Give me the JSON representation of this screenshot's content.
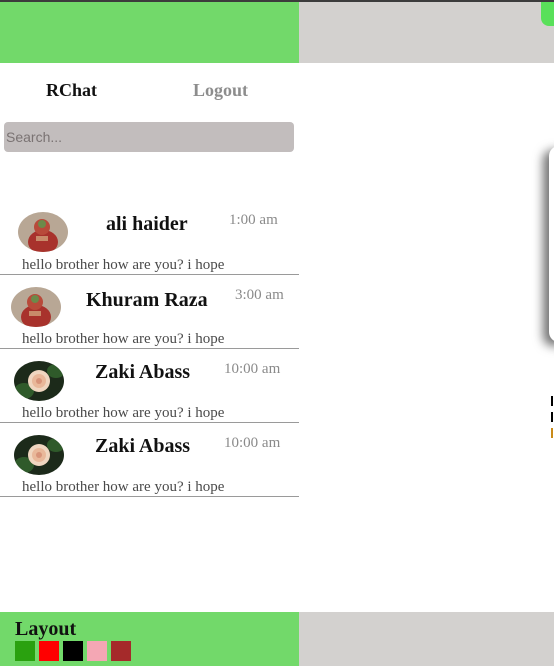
{
  "header": {
    "brand": "RChat",
    "logout_label": "Logout"
  },
  "search": {
    "placeholder": "Search...",
    "value": ""
  },
  "chats": [
    {
      "name": "ali haider",
      "time": "1:00 am",
      "preview": "hello brother how are you? i hope",
      "avatar": "avatar-red-portrait"
    },
    {
      "name": "Khuram Raza",
      "time": "3:00 am",
      "preview": "hello brother how are you? i hope",
      "avatar": "avatar-red-portrait"
    },
    {
      "name": "Zaki Abass",
      "time": "10:00 am",
      "preview": "hello brother how are you? i hope",
      "avatar": "avatar-rose"
    },
    {
      "name": "Zaki Abass",
      "time": "10:00 am",
      "preview": "hello brother how are you? i hope",
      "avatar": "avatar-rose"
    }
  ],
  "footer": {
    "layout_label": "Layout",
    "swatches": [
      {
        "name": "green",
        "color": "#2aa10f"
      },
      {
        "name": "red",
        "color": "#ff0000"
      },
      {
        "name": "black",
        "color": "#000000"
      },
      {
        "name": "pink",
        "color": "#f4a7b4"
      },
      {
        "name": "brown",
        "color": "#a52a2a"
      }
    ]
  },
  "colors": {
    "header_green": "#72d96a",
    "panel_gray": "#d3d1cf",
    "search_bg": "#c2bdbd"
  }
}
